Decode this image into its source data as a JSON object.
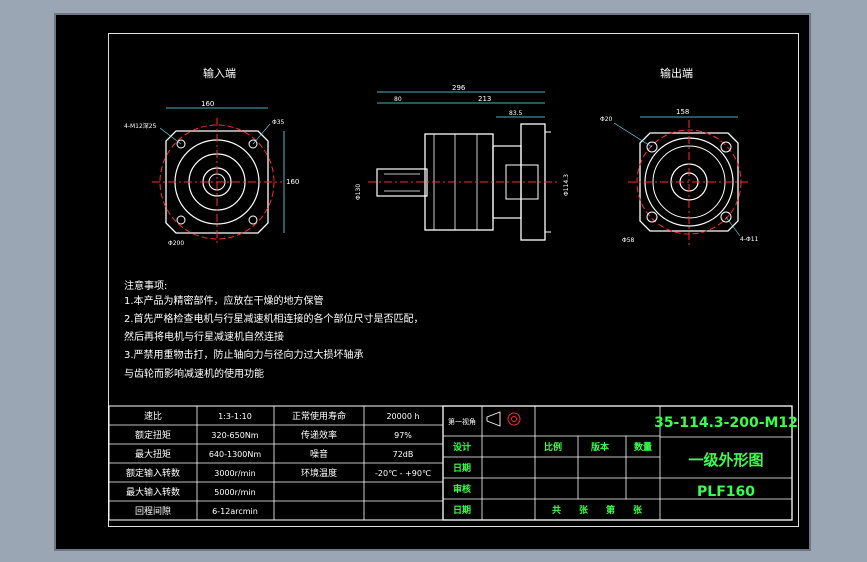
{
  "colors": {
    "background": "#9aa6b3",
    "canvas": "#000000",
    "line": "#ffffff",
    "center": "#ff2a2a",
    "dim": "#5fe9ff",
    "title_text": "#39ff4a"
  },
  "views": {
    "input_label": "输入端",
    "output_label": "输出端",
    "input_dims": {
      "width": "160",
      "height": "160",
      "bolt": "4-M12深25",
      "hole": "Φ35",
      "pcd": "Φ200"
    },
    "side_dims": {
      "total": "296",
      "body": "213",
      "shaft": "83.5",
      "left": "80",
      "center_d": "Φ130",
      "flange_d": "Φ114.3"
    },
    "output_dims": {
      "width": "158",
      "bolt": "4-Φ11",
      "hole": "Φ20",
      "pcd": "Φ58"
    }
  },
  "notes": {
    "title": "注意事项:",
    "lines": [
      "1.本产品为精密部件，应放在干燥的地方保管",
      "2.首先严格检查电机与行星减速机相连接的各个部位尺寸是否匹配，",
      "然后再将电机与行星减速机自然连接",
      "3.严禁用重物击打，防止轴向力与径向力过大损坏轴承",
      "与齿轮而影响减速机的使用功能"
    ]
  },
  "spec_table": {
    "rows": [
      [
        "速比",
        "1:3-1:10",
        "正常使用寿命",
        "20000 h"
      ],
      [
        "额定扭矩",
        "320-650Nm",
        "传递效率",
        "97%"
      ],
      [
        "最大扭矩",
        "640-1300Nm",
        "噪音",
        "72dB"
      ],
      [
        "额定输入转数",
        "3000r/min",
        "环境温度",
        "-20℃ - +90℃"
      ],
      [
        "最大输入转数",
        "5000r/min",
        "",
        ""
      ],
      [
        "回程间隙",
        "6-12arcmin",
        "",
        ""
      ]
    ]
  },
  "title_block": {
    "projection_label": "第一视角",
    "code": "35-114.3-200-M12",
    "name": "一级外形图",
    "model": "PLF160",
    "labels": {
      "design": "设计",
      "date1": "日期",
      "check": "审核",
      "date2": "日期",
      "scale": "比例",
      "version": "版本",
      "quantity": "数量",
      "sheets": "共　　张　　第　　张"
    }
  }
}
